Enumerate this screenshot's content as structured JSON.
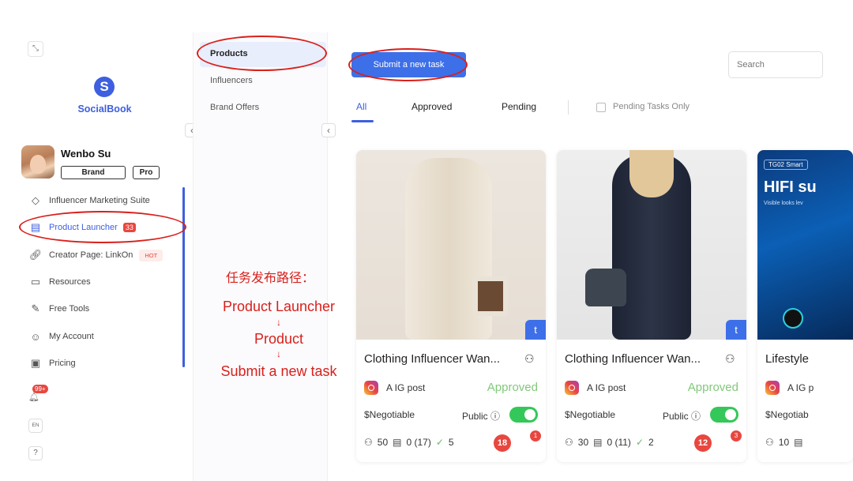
{
  "sidebar": {
    "brand_name": "SocialBook",
    "logo_glyph": "S",
    "user_name": "Wenbo Su",
    "plan_badge": "Brand",
    "tier_badge": "Pro",
    "items": [
      {
        "label": "Influencer Marketing Suite",
        "icon": "diamond-icon"
      },
      {
        "label": "Product Launcher",
        "icon": "document-icon",
        "count": "33"
      },
      {
        "label": "Creator Page: LinkOn",
        "icon": "link-icon",
        "tag": "HOT"
      },
      {
        "label": "Resources",
        "icon": "folder-icon"
      },
      {
        "label": "Free Tools",
        "icon": "tools-icon"
      },
      {
        "label": "My Account",
        "icon": "user-icon"
      },
      {
        "label": "Pricing",
        "icon": "wallet-icon"
      }
    ],
    "notifications_count": "99+",
    "language": "EN",
    "help": "?"
  },
  "subnav": {
    "items": [
      "Products",
      "Influencers",
      "Brand Offers"
    ]
  },
  "toolbar": {
    "submit_label": "Submit a new task",
    "search_placeholder": "Search"
  },
  "tabs": [
    "All",
    "Approved",
    "Pending"
  ],
  "filter_label": "Pending Tasks Only",
  "cards": [
    {
      "title": "Clothing Influencer Wan...",
      "post_type": "A IG post",
      "status": "Approved",
      "price": "$Negotiable",
      "visibility": "Public",
      "stats": {
        "applicants": "50",
        "tasks": "0 (17)",
        "approved": "5"
      },
      "pending_count": "18",
      "alert_count": "1",
      "badge": "t"
    },
    {
      "title": "Clothing Influencer Wan...",
      "post_type": "A IG post",
      "status": "Approved",
      "price": "$Negotiable",
      "visibility": "Public",
      "stats": {
        "applicants": "30",
        "tasks": "0 (11)",
        "approved": "2"
      },
      "pending_count": "12",
      "alert_count": "3",
      "badge": "t"
    },
    {
      "title": "Lifestyle",
      "post_type": "A IG p",
      "price": "$Negotiab",
      "stats": {
        "applicants": "10"
      },
      "image_tag": "TG02 Smart",
      "image_title": "HIFI su",
      "image_sub": "Visible looks lev"
    }
  ],
  "annotation": {
    "heading": "任务发布路径：",
    "step1": "Product Launcher",
    "step2": "Product",
    "step3": "Submit a new task",
    "arrow": "↓"
  },
  "colors": {
    "accent": "#3d5fe0",
    "approved": "#82c97a",
    "alert": "#e8473f",
    "annotation": "#d9201c"
  }
}
